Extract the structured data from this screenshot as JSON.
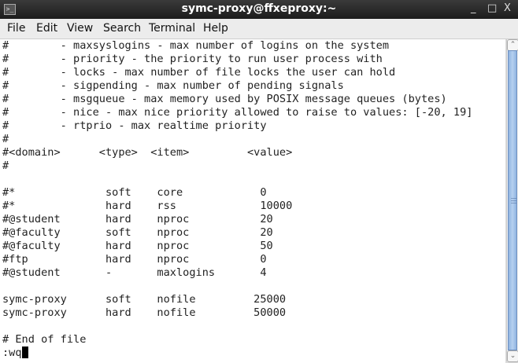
{
  "window": {
    "title": "symc-proxy@ffxeproxy:~",
    "minimize": "_",
    "maximize": "□",
    "close": "X",
    "icon_glyph": ">_"
  },
  "menu": [
    "File",
    "Edit",
    "View",
    "Search",
    "Terminal",
    "Help"
  ],
  "lines": [
    "#        - maxsyslogins - max number of logins on the system",
    "#        - priority - the priority to run user process with",
    "#        - locks - max number of file locks the user can hold",
    "#        - sigpending - max number of pending signals",
    "#        - msgqueue - max memory used by POSIX message queues (bytes)",
    "#        - nice - max nice priority allowed to raise to values: [-20, 19]",
    "#        - rtprio - max realtime priority",
    "#",
    "#<domain>      <type>  <item>         <value>",
    "#",
    "",
    "#*              soft    core            0",
    "#*              hard    rss             10000",
    "#@student       hard    nproc           20",
    "#@faculty       soft    nproc           20",
    "#@faculty       hard    nproc           50",
    "#ftp            hard    nproc           0",
    "#@student       -       maxlogins       4",
    "",
    "symc-proxy      soft    nofile         25000",
    "symc-proxy      hard    nofile         50000",
    "",
    "# End of file",
    ":wq"
  ]
}
